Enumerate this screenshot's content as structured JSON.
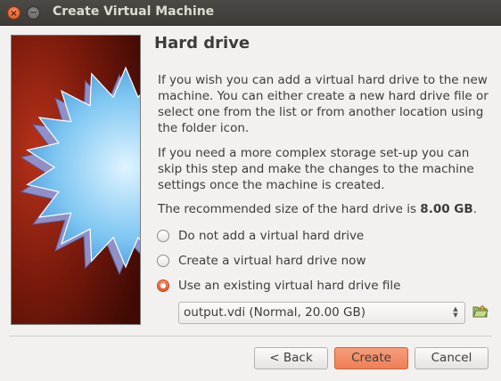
{
  "window": {
    "title": "Create Virtual Machine",
    "close_glyph": "×",
    "minimize_glyph": "−"
  },
  "page": {
    "heading": "Hard drive",
    "paragraph1": "If you wish you can add a virtual hard drive to the new machine. You can either create a new hard drive file or select one from the list or from another location using the folder icon.",
    "paragraph2": "If you need a more complex storage set-up you can skip this step and make the changes to the machine settings once the machine is created.",
    "recommended_prefix": "The recommended size of the hard drive is ",
    "recommended_size": "8.00 GB",
    "recommended_suffix": "."
  },
  "options": [
    {
      "label": "Do not add a virtual hard drive",
      "checked": false
    },
    {
      "label": "Create a virtual hard drive now",
      "checked": false
    },
    {
      "label": "Use an existing virtual hard drive file",
      "checked": true
    }
  ],
  "disk_select": {
    "value": "output.vdi (Normal, 20.00 GB)",
    "folder_icon": "folder-open-icon"
  },
  "buttons": {
    "back": "< Back",
    "create": "Create",
    "cancel": "Cancel"
  },
  "colors": {
    "accent": "#ef7f55",
    "titlebar": "#3c3b37",
    "art_background": "#6d1508"
  }
}
